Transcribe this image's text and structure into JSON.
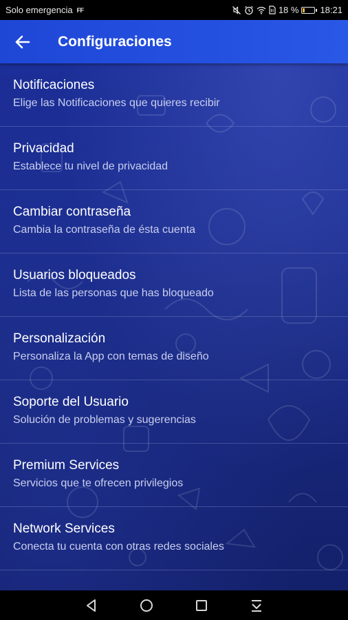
{
  "status_bar": {
    "carrier": "Solo emergencia",
    "carrier_flag": "FF",
    "battery_percent": "18 %",
    "battery_level": 0.18,
    "time": "18:21",
    "icons": [
      "mute-icon",
      "alarm-icon",
      "wifi-icon",
      "sim-icon",
      "battery-icon"
    ]
  },
  "app_bar": {
    "title": "Configuraciones",
    "back_icon": "arrow-left-icon"
  },
  "settings": [
    {
      "title": "Notificaciones",
      "subtitle": "Elige las Notificaciones que quieres recibir"
    },
    {
      "title": "Privacidad",
      "subtitle": "Establece tu nivel de privacidad"
    },
    {
      "title": "Cambiar contraseña",
      "subtitle": "Cambia la contraseña de ésta cuenta"
    },
    {
      "title": "Usuarios bloqueados",
      "subtitle": "Lista de las personas que has bloqueado"
    },
    {
      "title": "Personalización",
      "subtitle": "Personaliza la App con temas de diseño"
    },
    {
      "title": "Soporte del Usuario",
      "subtitle": "Solución de problemas y sugerencias"
    },
    {
      "title": "Premium Services",
      "subtitle": "Servicios que te ofrecen privilegios"
    },
    {
      "title": "Network Services",
      "subtitle": "Conecta tu cuenta con otras redes sociales"
    }
  ],
  "nav_bar": {
    "buttons": [
      "back-triangle-icon",
      "home-circle-icon",
      "recents-square-icon",
      "notification-pull-icon"
    ]
  },
  "colors": {
    "app_bar": "#2450e0",
    "background": "#1b2d8e",
    "subtitle": "#c9cfee",
    "battery_fill": "#f2b33d"
  }
}
